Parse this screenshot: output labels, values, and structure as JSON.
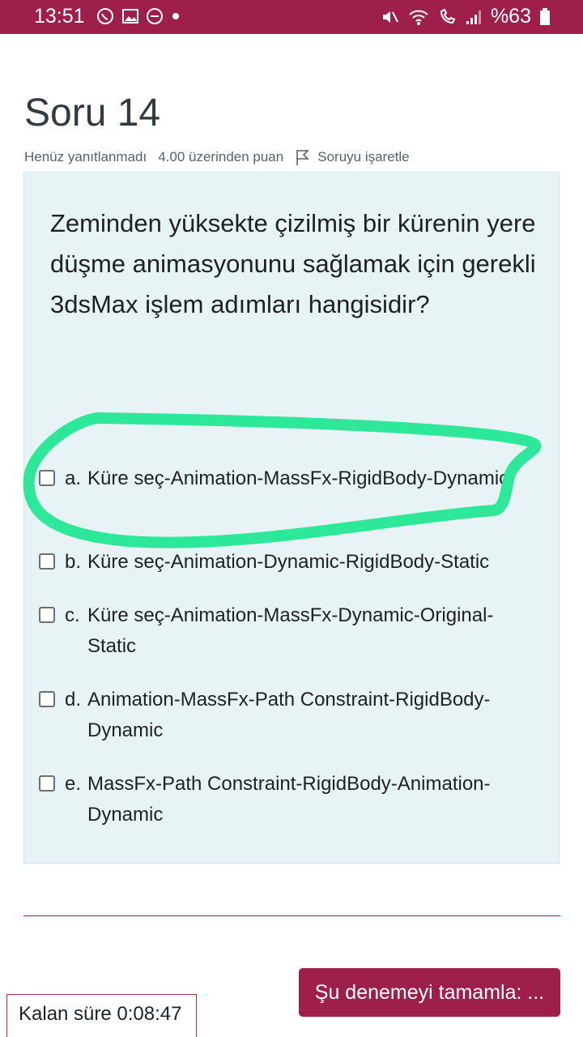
{
  "status_bar": {
    "time": "13:51",
    "battery": "%63",
    "icons": [
      "whatsapp-icon",
      "image-icon",
      "do-not-disturb-icon",
      "dot-icon",
      "mute-icon",
      "wifi-icon",
      "wifi-call-icon",
      "signal-icon",
      "battery-icon"
    ]
  },
  "question": {
    "title": "Soru 14",
    "status": "Henüz yanıtlanmadı",
    "points": "4.00 üzerinden puan",
    "flag_label": "Soruyu işaretle",
    "text": "Zeminden yüksekte çizilmiş bir kürenin yere düşme animasyonunu sağlamak için gerekli 3dsMax işlem adımları hangisidir?"
  },
  "options": [
    {
      "letter": "a.",
      "text": "Küre seç-Animation-MassFx-RigidBody-Dynamic",
      "checked": false,
      "highlighted": true
    },
    {
      "letter": "b.",
      "text": "Küre seç-Animation-Dynamic-RigidBody-Static",
      "checked": false
    },
    {
      "letter": "c.",
      "text": "Küre seç-Animation-MassFx-Dynamic-Original-Static",
      "checked": false
    },
    {
      "letter": "d.",
      "text": "Animation-MassFx-Path Constraint-RigidBody-Dynamic",
      "checked": false
    },
    {
      "letter": "e.",
      "text": "MassFx-Path Constraint-RigidBody-Animation-Dynamic",
      "checked": false
    }
  ],
  "footer": {
    "finish_label": "Şu denemeyi tamamla: ...",
    "timer": "Kalan süre 0:08:47"
  },
  "colors": {
    "brand": "#9e1f4a",
    "question_bg": "#e7f3f5",
    "highlight": "#2ee89a"
  }
}
